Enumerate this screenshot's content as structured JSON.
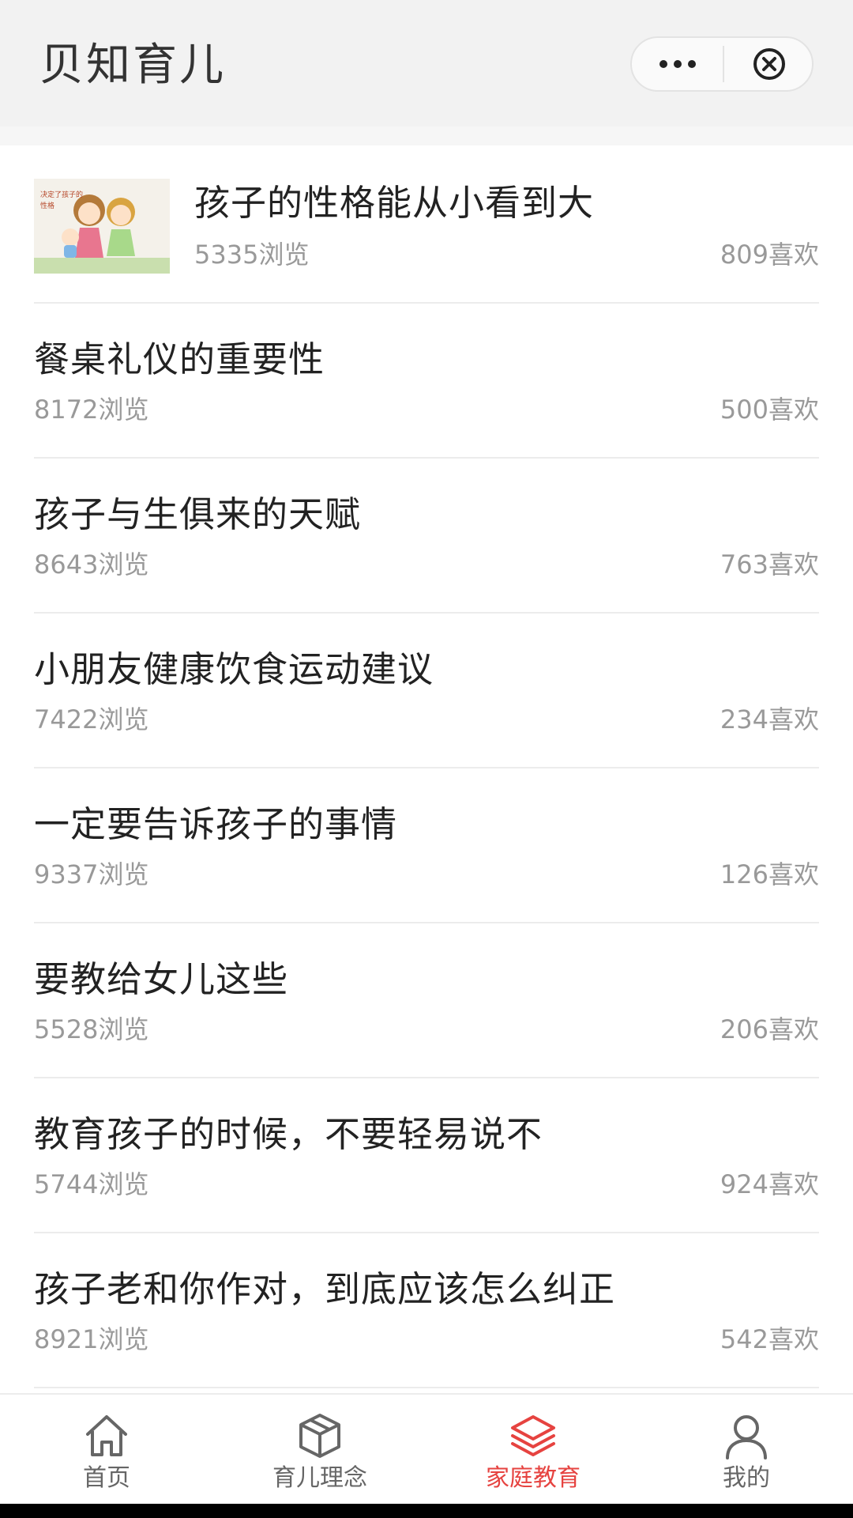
{
  "header": {
    "title": "贝知育儿",
    "more_icon": "more-dots-icon",
    "close_icon": "close-circle-icon"
  },
  "articles": [
    {
      "title": "孩子的性格能从小看到大",
      "views": "5335浏览",
      "likes": "809喜欢",
      "thumb_caption": "决定了孩子的性格"
    },
    {
      "title": "餐桌礼仪的重要性",
      "views": "8172浏览",
      "likes": "500喜欢"
    },
    {
      "title": "孩子与生俱来的天赋",
      "views": "8643浏览",
      "likes": "763喜欢"
    },
    {
      "title": "小朋友健康饮食运动建议",
      "views": "7422浏览",
      "likes": "234喜欢"
    },
    {
      "title": "一定要告诉孩子的事情",
      "views": "9337浏览",
      "likes": "126喜欢"
    },
    {
      "title": "要教给女儿这些",
      "views": "5528浏览",
      "likes": "206喜欢"
    },
    {
      "title": "教育孩子的时候，不要轻易说不",
      "views": "5744浏览",
      "likes": "924喜欢"
    },
    {
      "title": "孩子老和你作对，到底应该怎么纠正",
      "views": "8921浏览",
      "likes": "542喜欢"
    }
  ],
  "tabbar": {
    "tabs": [
      {
        "label": "首页",
        "icon": "home-icon"
      },
      {
        "label": "育儿理念",
        "icon": "cube-icon"
      },
      {
        "label": "家庭教育",
        "icon": "layers-icon",
        "active": true
      },
      {
        "label": "我的",
        "icon": "user-icon"
      }
    ]
  },
  "colors": {
    "active": "#e64340",
    "inactive": "#666666",
    "meta_text": "#999999"
  }
}
